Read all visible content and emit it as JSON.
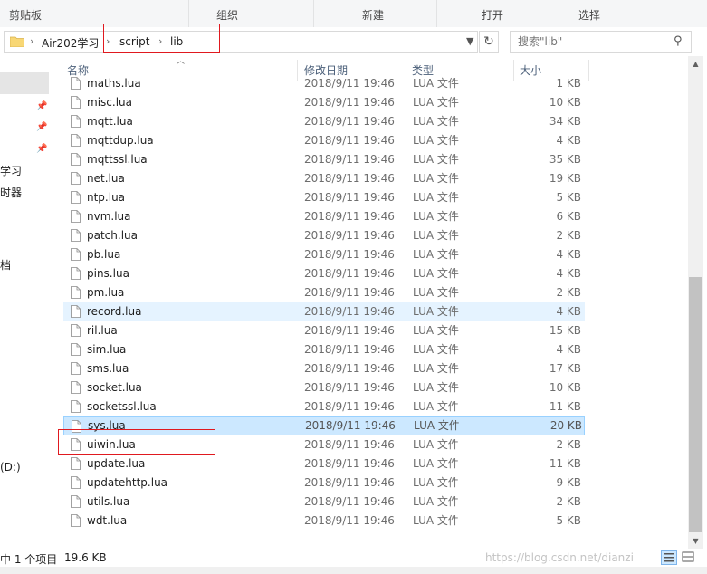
{
  "ribbon": {
    "groups": [
      "剪贴板",
      "组织",
      "新建",
      "打开",
      "选择"
    ]
  },
  "address": {
    "breadcrumbs": [
      "Air202学习",
      "script",
      "lib"
    ]
  },
  "search": {
    "placeholder": "搜索\"lib\""
  },
  "nav": {
    "labels": [
      "学习",
      "时器",
      "档",
      "(D:)"
    ]
  },
  "columns": {
    "name": "名称",
    "date": "修改日期",
    "type": "类型",
    "size": "大小"
  },
  "files": [
    {
      "name": "maths.lua",
      "date": "2018/9/11 19:46",
      "type": "LUA 文件",
      "size": "1 KB"
    },
    {
      "name": "misc.lua",
      "date": "2018/9/11 19:46",
      "type": "LUA 文件",
      "size": "10 KB"
    },
    {
      "name": "mqtt.lua",
      "date": "2018/9/11 19:46",
      "type": "LUA 文件",
      "size": "34 KB"
    },
    {
      "name": "mqttdup.lua",
      "date": "2018/9/11 19:46",
      "type": "LUA 文件",
      "size": "4 KB"
    },
    {
      "name": "mqttssl.lua",
      "date": "2018/9/11 19:46",
      "type": "LUA 文件",
      "size": "35 KB"
    },
    {
      "name": "net.lua",
      "date": "2018/9/11 19:46",
      "type": "LUA 文件",
      "size": "19 KB"
    },
    {
      "name": "ntp.lua",
      "date": "2018/9/11 19:46",
      "type": "LUA 文件",
      "size": "5 KB"
    },
    {
      "name": "nvm.lua",
      "date": "2018/9/11 19:46",
      "type": "LUA 文件",
      "size": "6 KB"
    },
    {
      "name": "patch.lua",
      "date": "2018/9/11 19:46",
      "type": "LUA 文件",
      "size": "2 KB"
    },
    {
      "name": "pb.lua",
      "date": "2018/9/11 19:46",
      "type": "LUA 文件",
      "size": "4 KB"
    },
    {
      "name": "pins.lua",
      "date": "2018/9/11 19:46",
      "type": "LUA 文件",
      "size": "4 KB"
    },
    {
      "name": "pm.lua",
      "date": "2018/9/11 19:46",
      "type": "LUA 文件",
      "size": "2 KB"
    },
    {
      "name": "record.lua",
      "date": "2018/9/11 19:46",
      "type": "LUA 文件",
      "size": "4 KB"
    },
    {
      "name": "ril.lua",
      "date": "2018/9/11 19:46",
      "type": "LUA 文件",
      "size": "15 KB"
    },
    {
      "name": "sim.lua",
      "date": "2018/9/11 19:46",
      "type": "LUA 文件",
      "size": "4 KB"
    },
    {
      "name": "sms.lua",
      "date": "2018/9/11 19:46",
      "type": "LUA 文件",
      "size": "17 KB"
    },
    {
      "name": "socket.lua",
      "date": "2018/9/11 19:46",
      "type": "LUA 文件",
      "size": "10 KB"
    },
    {
      "name": "socketssl.lua",
      "date": "2018/9/11 19:46",
      "type": "LUA 文件",
      "size": "11 KB"
    },
    {
      "name": "sys.lua",
      "date": "2018/9/11 19:46",
      "type": "LUA 文件",
      "size": "20 KB",
      "selected": true
    },
    {
      "name": "uiwin.lua",
      "date": "2018/9/11 19:46",
      "type": "LUA 文件",
      "size": "2 KB"
    },
    {
      "name": "update.lua",
      "date": "2018/9/11 19:46",
      "type": "LUA 文件",
      "size": "11 KB"
    },
    {
      "name": "updatehttp.lua",
      "date": "2018/9/11 19:46",
      "type": "LUA 文件",
      "size": "9 KB"
    },
    {
      "name": "utils.lua",
      "date": "2018/9/11 19:46",
      "type": "LUA 文件",
      "size": "2 KB"
    },
    {
      "name": "wdt.lua",
      "date": "2018/9/11 19:46",
      "type": "LUA 文件",
      "size": "5 KB"
    }
  ],
  "status": {
    "selection": "中 1 个项目",
    "size": "19.6 KB"
  },
  "watermark": "https://blog.csdn.net/dianzi",
  "colors": {
    "selection_bg": "#cce8ff",
    "selection_border": "#99d1ff",
    "highlight_box": "#e0191f",
    "header_text": "#4c607a"
  }
}
